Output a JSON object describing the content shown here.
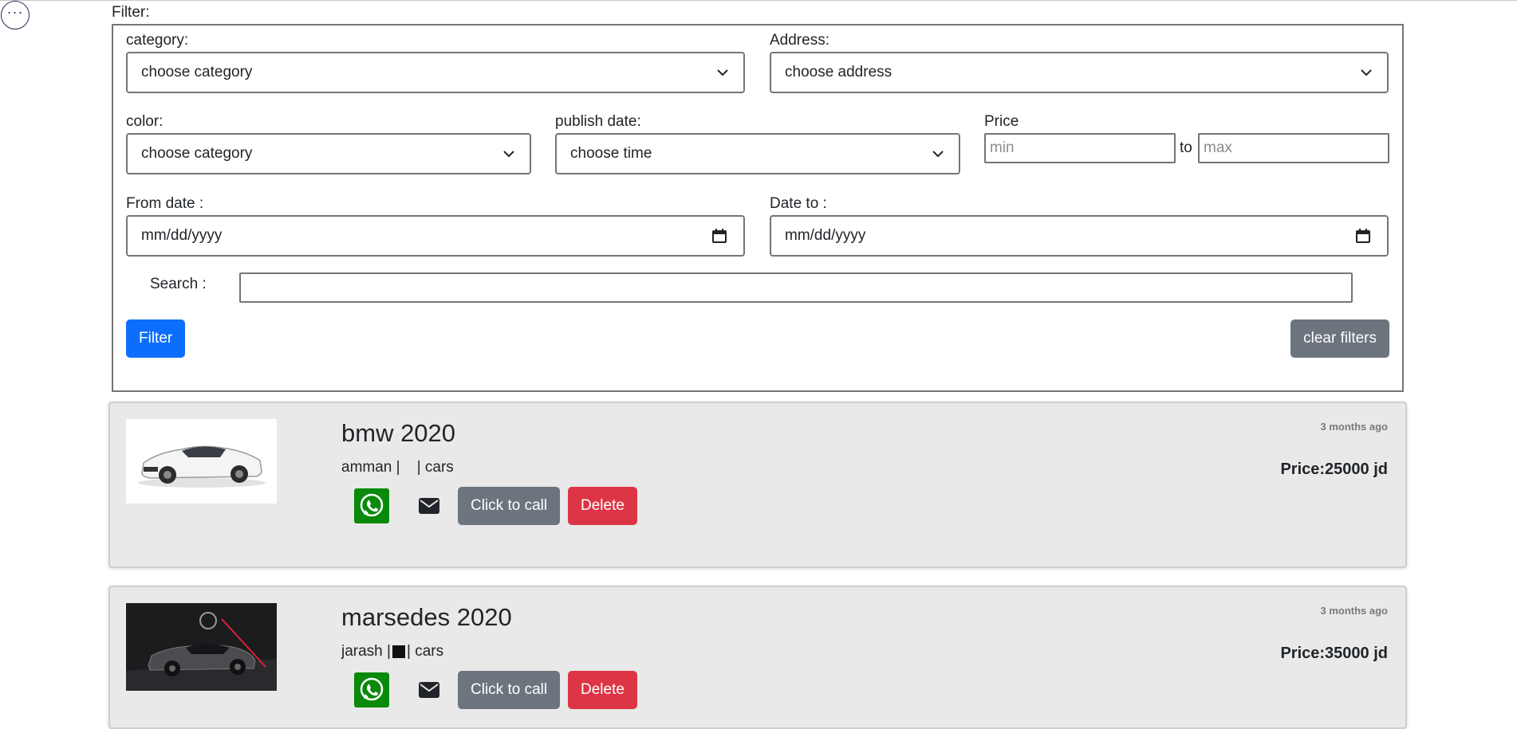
{
  "top": {
    "more_label": "···"
  },
  "filter": {
    "legend": "Filter:",
    "category_label": "category:",
    "category_value": "choose category",
    "address_label": "Address:",
    "address_value": "choose address",
    "color_label": "color:",
    "color_value": "choose category",
    "publish_label": "publish date:",
    "publish_value": "choose time",
    "price_label": "Price",
    "price_min_placeholder": "min",
    "price_to": "to",
    "price_max_placeholder": "max",
    "from_label": "From date :",
    "from_value": "mm/dd/yyyy",
    "to_label": "Date to :",
    "to_value": "mm/dd/yyyy",
    "search_label": "Search :",
    "search_value": "",
    "filter_button": "Filter",
    "clear_button": "clear filters"
  },
  "listings": [
    {
      "title": "bmw 2020",
      "city": "amman",
      "category": "cars",
      "time": "3 months ago",
      "price": "Price:25000 jd",
      "call_label": "Click to call",
      "delete_label": "Delete"
    },
    {
      "title": "marsedes 2020",
      "city": "jarash",
      "category": "cars",
      "time": "3 months ago",
      "price": "Price:35000 jd",
      "call_label": "Click to call",
      "delete_label": "Delete"
    }
  ],
  "colors": {
    "primary": "#0d6efd",
    "secondary": "#6c757d",
    "danger": "#dc3545",
    "whatsapp": "#0a8a0a",
    "card_bg": "#e9e9e9"
  }
}
